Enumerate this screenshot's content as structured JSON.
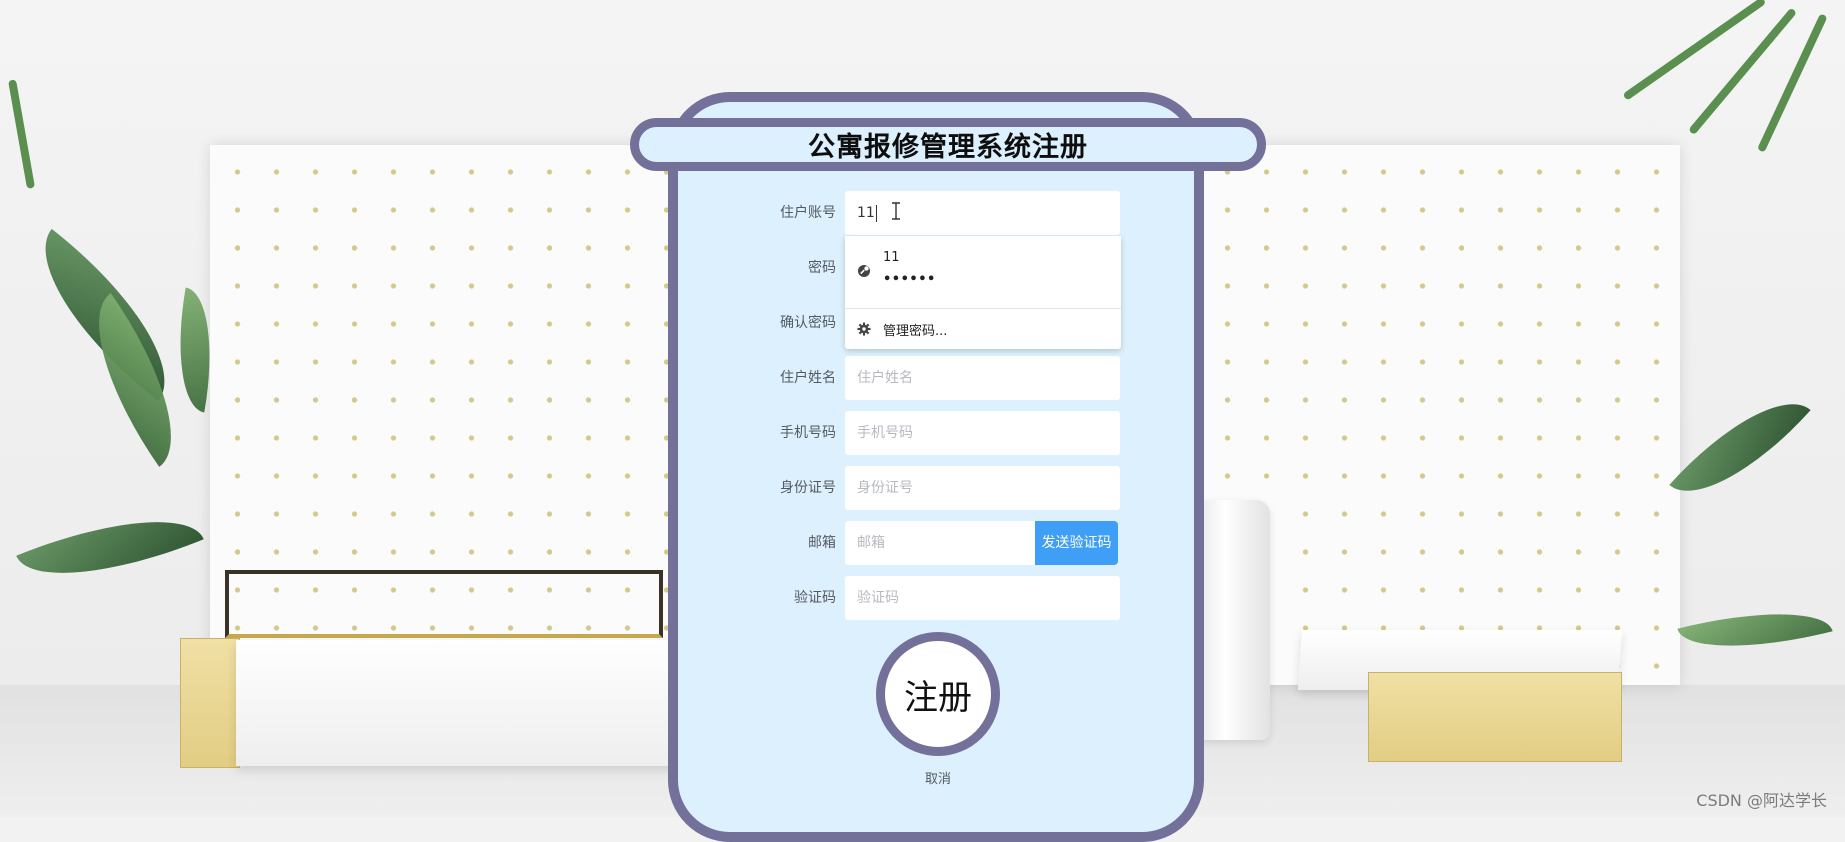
{
  "page": {
    "title": "公寓报修管理系统注册"
  },
  "form": {
    "fields": [
      {
        "label": "住户账号",
        "value": "11",
        "placeholder": ""
      },
      {
        "label": "密码",
        "value": "",
        "placeholder": ""
      },
      {
        "label": "确认密码",
        "value": "",
        "placeholder": ""
      },
      {
        "label": "住户姓名",
        "value": "",
        "placeholder": "住户姓名"
      },
      {
        "label": "手机号码",
        "value": "",
        "placeholder": "手机号码"
      },
      {
        "label": "身份证号",
        "value": "",
        "placeholder": "身份证号"
      },
      {
        "label": "邮箱",
        "value": "",
        "placeholder": "邮箱"
      },
      {
        "label": "验证码",
        "value": "",
        "placeholder": "验证码"
      }
    ],
    "send_code_label": "发送验证码",
    "register_label": "注册",
    "cancel_label": "取消"
  },
  "autofill": {
    "username": "11",
    "password_mask": "••••••",
    "manage_label": "管理密码...",
    "entry_icon": "key-globe-icon",
    "manage_icon": "gear-icon"
  },
  "colors": {
    "panel_bg": "#dcf0fd",
    "panel_border": "#737199",
    "send_button": "#3f9ef5"
  },
  "watermark": "CSDN @阿达学长"
}
